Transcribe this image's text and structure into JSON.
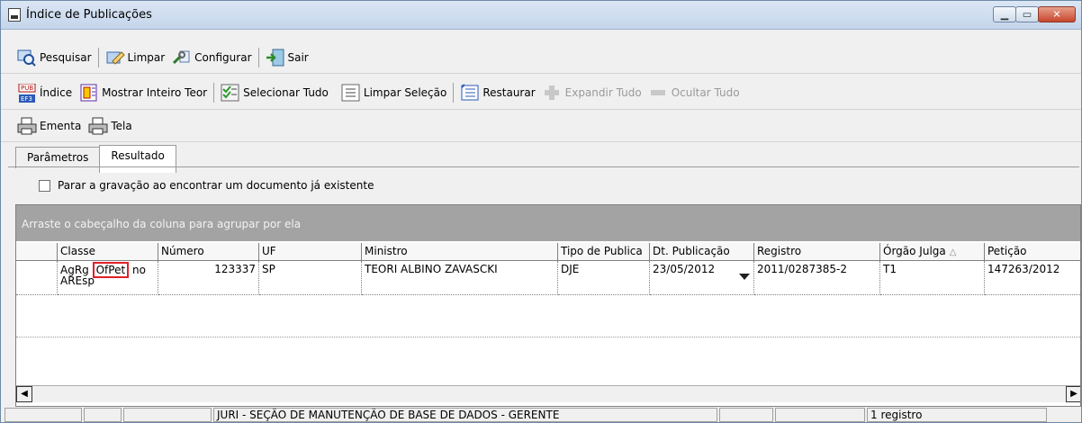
{
  "window": {
    "title": "Índice de Publicações"
  },
  "toolbar1": {
    "search": "Pesquisar",
    "clear": "Limpar",
    "configure": "Configurar",
    "exit": "Sair"
  },
  "toolbar2": {
    "index": "Índice",
    "show_full": "Mostrar Inteiro Teor",
    "select_all": "Selecionar Tudo",
    "clear_selection": "Limpar Seleção",
    "restore": "Restaurar",
    "expand_all": "Expandir Tudo",
    "hide_all": "Ocultar Tudo"
  },
  "toolbar3": {
    "ementa": "Ementa",
    "tela": "Tela"
  },
  "tabs": [
    {
      "label": "Parâmetros"
    },
    {
      "label": "Resultado"
    }
  ],
  "checkbox": {
    "label": "Parar a gravação ao encontrar um documento já existente",
    "checked": false
  },
  "grid": {
    "group_hint": "Arraste o cabeçalho da coluna para agrupar por ela",
    "columns": [
      "Classe",
      "Número",
      "UF",
      "Ministro",
      "Tipo de Publica",
      "Dt. Publicação",
      "Registro",
      "Órgão Julga",
      "Petição"
    ],
    "rows": [
      {
        "classe_a": "AgRg",
        "classe_b": "OfPet",
        "classe_c": "no",
        "classe_d": "AREsp",
        "numero": "123337",
        "uf": "SP",
        "ministro": "TEORI ALBINO ZAVASCKI",
        "tipo": "DJE",
        "dt_publicacao": "23/05/2012",
        "registro": "2011/0287385-2",
        "orgao": "T1",
        "peticao": "147263/2012"
      }
    ]
  },
  "status": {
    "department": "JURI - SEÇÃO DE MANUTENÇÃO DE BASE DE DADOS - GERENTE",
    "count": "1 registro"
  },
  "colors": {
    "accent_highlight": "#e0202a",
    "group_bar": "#a3a3a3"
  }
}
